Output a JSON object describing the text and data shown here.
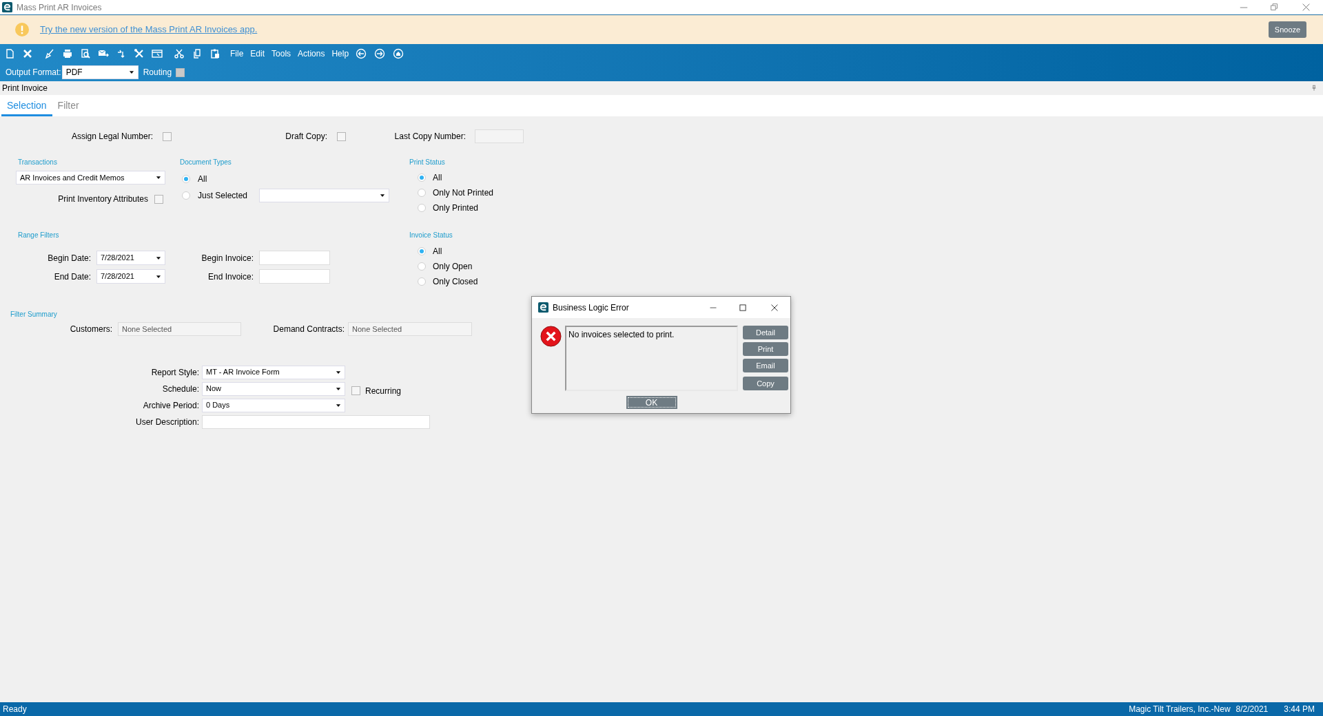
{
  "window": {
    "title": "Mass Print AR Invoices"
  },
  "banner": {
    "link": "Try the new version of the Mass Print AR Invoices app.",
    "button": "Snooze"
  },
  "toolbar": {
    "menus": [
      "File",
      "Edit",
      "Tools",
      "Actions",
      "Help"
    ],
    "output_format": {
      "label": "Output Format:",
      "value": "PDF"
    },
    "routing": {
      "label": "Routing",
      "checked": false
    }
  },
  "panel_title": "Print Invoice",
  "tabs": [
    {
      "label": "Selection",
      "selected": true
    },
    {
      "label": "Filter",
      "selected": false
    }
  ],
  "form": {
    "assign_legal_number": {
      "label": "Assign Legal Number:",
      "checked": false
    },
    "draft_copy": {
      "label": "Draft Copy:",
      "checked": false
    },
    "last_copy_number": {
      "label": "Last Copy Number:"
    },
    "transactions": {
      "heading": "Transactions",
      "value": "AR Invoices and Credit Memos"
    },
    "print_inventory_attributes": {
      "label": "Print Inventory Attributes",
      "checked": false
    },
    "document_types": {
      "heading": "Document Types",
      "options": [
        {
          "label": "All",
          "selected": true
        },
        {
          "label": "Just Selected",
          "selected": false
        }
      ]
    },
    "print_status": {
      "heading": "Print Status",
      "options": [
        {
          "label": "All",
          "selected": true
        },
        {
          "label": "Only Not Printed",
          "selected": false
        },
        {
          "label": "Only Printed",
          "selected": false
        }
      ]
    },
    "range_filters": {
      "heading": "Range Filters",
      "begin_date": {
        "label": "Begin Date:",
        "value": "7/28/2021"
      },
      "end_date": {
        "label": "End Date:",
        "value": "7/28/2021"
      },
      "begin_invoice": {
        "label": "Begin Invoice:"
      },
      "end_invoice": {
        "label": "End Invoice:"
      }
    },
    "invoice_status": {
      "heading": "Invoice Status",
      "options": [
        {
          "label": "All",
          "selected": true
        },
        {
          "label": "Only Open",
          "selected": false
        },
        {
          "label": "Only Closed",
          "selected": false
        }
      ]
    },
    "filter_summary": {
      "heading": "Filter Summary",
      "customers": {
        "label": "Customers:",
        "value": "None Selected"
      },
      "demand_contracts": {
        "label": "Demand Contracts:",
        "value": "None Selected"
      }
    },
    "report_style": {
      "label": "Report Style:",
      "value": "MT - AR Invoice Form"
    },
    "schedule": {
      "label": "Schedule:",
      "value": "Now"
    },
    "recurring": {
      "label": "Recurring",
      "checked": false
    },
    "archive_period": {
      "label": "Archive Period:",
      "value": "0 Days"
    },
    "user_description": {
      "label": "User Description:"
    }
  },
  "dialog": {
    "title": "Business Logic Error",
    "message": "No invoices selected to print.",
    "side_buttons": [
      "Detail",
      "Print",
      "Email",
      "Copy"
    ],
    "ok": "OK"
  },
  "status_bar": {
    "left": "Ready",
    "company": "Magic Tilt Trailers, Inc.-New",
    "date": "8/2/2021",
    "time": "3:44 PM"
  }
}
